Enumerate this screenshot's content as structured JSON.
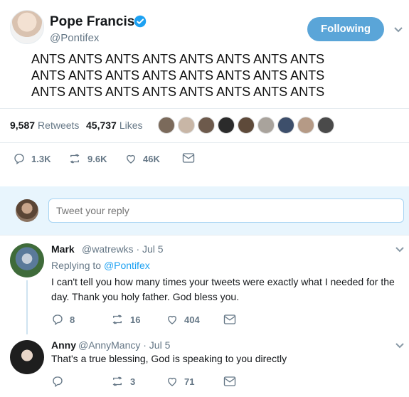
{
  "tweet": {
    "display_name": "Pope Francis",
    "handle": "@Pontifex",
    "follow_label": "Following",
    "text": "ANTS ANTS ANTS ANTS ANTS ANTS ANTS ANTS\nANTS ANTS ANTS ANTS ANTS ANTS ANTS ANTS\nANTS ANTS ANTS ANTS ANTS ANTS ANTS ANTS",
    "retweets_count": "9,587",
    "retweets_label": "Retweets",
    "likes_count": "45,737",
    "likes_label": "Likes",
    "actions": {
      "replies": "1.3K",
      "retweets": "9.6K",
      "likes": "46K"
    }
  },
  "compose": {
    "placeholder": "Tweet your reply"
  },
  "replies": [
    {
      "name": "Mark",
      "handle": "@watrewks",
      "date": "· Jul 5",
      "replying_prefix": "Replying to",
      "replying_to": "@Pontifex",
      "text": "I can't tell you how many times your tweets were exactly what I needed for the day. Thank you holy father. God bless you.",
      "replies": "8",
      "retweets": "16",
      "likes": "404"
    },
    {
      "name": "Anny",
      "handle": "@AnnyMancy",
      "date": "· Jul 5",
      "text": "That's a true blessing, God is speaking to you directly",
      "retweets": "3",
      "likes": "71"
    }
  ],
  "colors": {
    "accent": "#1da1f2",
    "follow_button": "#5aa5d8",
    "muted": "#657786",
    "compose_background": "#e8f5fd"
  }
}
